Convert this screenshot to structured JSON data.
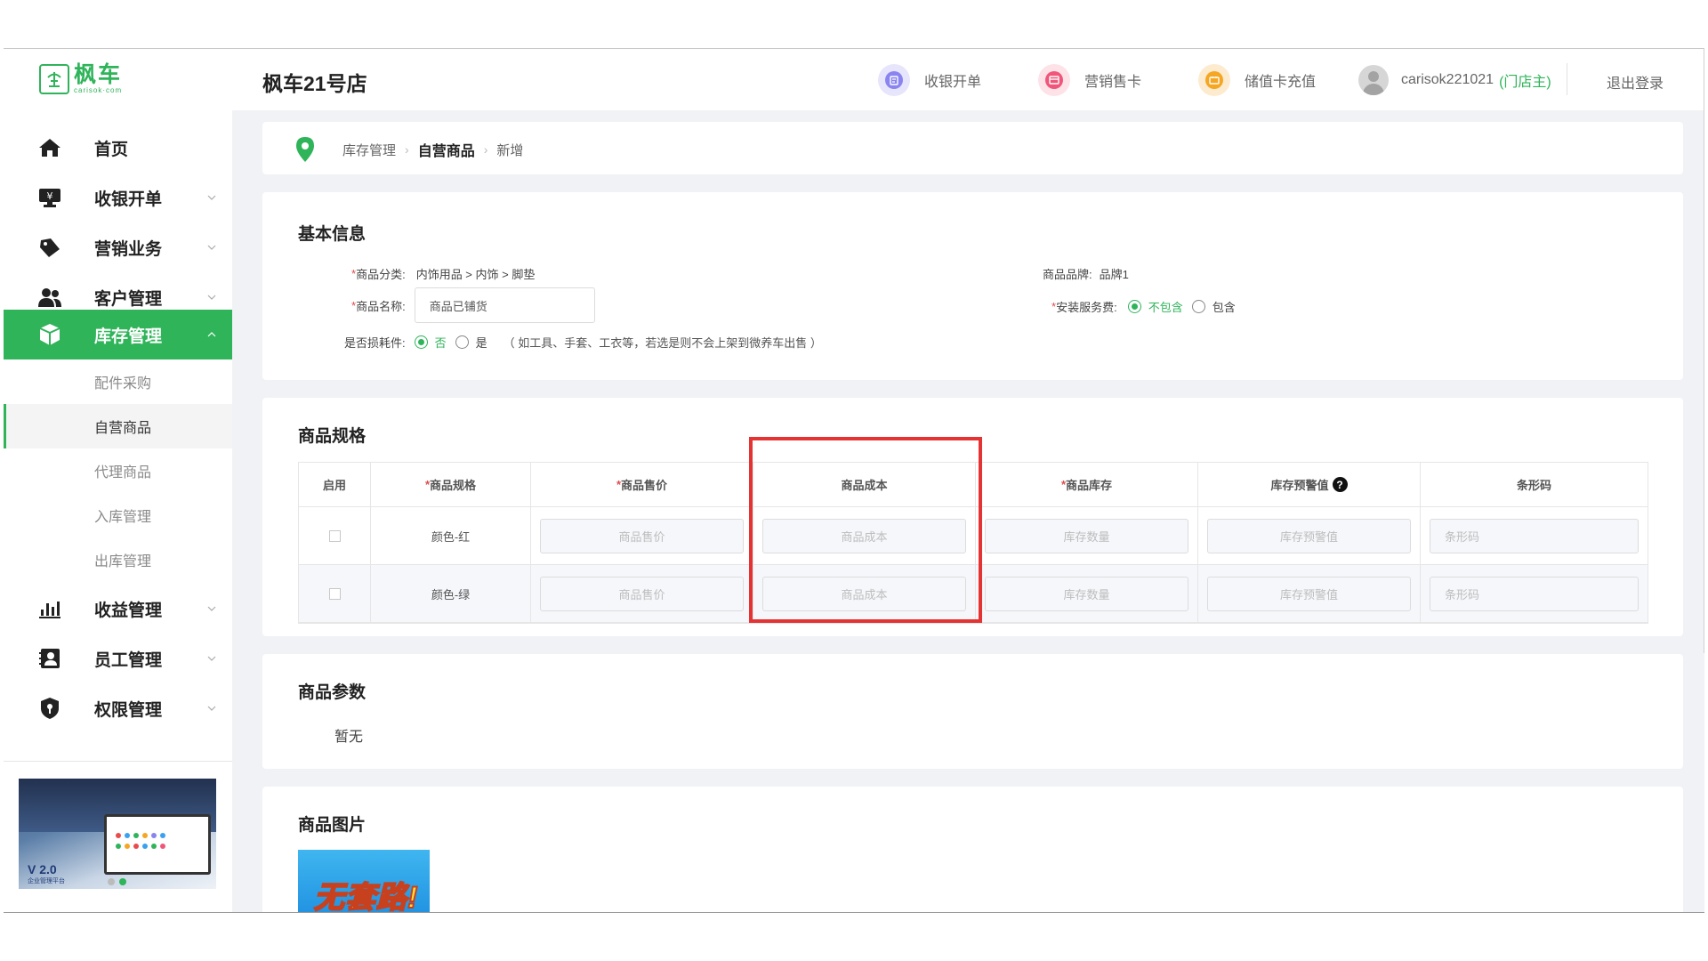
{
  "app": {
    "logo": {
      "cn": "枫车",
      "en": "carisok·com"
    },
    "shop_title": "枫车21号店",
    "brand_color": "#2fb45a"
  },
  "header": {
    "actions": [
      {
        "label": "收银开单",
        "icon": "cashier-order-icon",
        "color": "#8a84f0"
      },
      {
        "label": "营销售卡",
        "icon": "sell-card-icon",
        "color": "#f0567a"
      },
      {
        "label": "储值卡充值",
        "icon": "recharge-card-icon",
        "color": "#f5a623"
      }
    ],
    "user": {
      "name": "carisok221021",
      "role": "(门店主)"
    },
    "logout": "退出登录"
  },
  "sidebar": {
    "items": [
      {
        "label": "首页",
        "icon": "home-icon"
      },
      {
        "label": "收银开单",
        "icon": "cashier-icon"
      },
      {
        "label": "营销业务",
        "icon": "marketing-icon"
      },
      {
        "label": "客户管理",
        "icon": "customers-icon"
      },
      {
        "label": "库存管理",
        "icon": "inventory-box-icon",
        "active": true
      },
      {
        "label": "收益管理",
        "icon": "revenue-chart-icon"
      },
      {
        "label": "员工管理",
        "icon": "staff-icon"
      },
      {
        "label": "权限管理",
        "icon": "permission-shield-icon"
      }
    ],
    "sub_items": [
      {
        "label": "配件采购"
      },
      {
        "label": "自营商品",
        "active": true
      },
      {
        "label": "代理商品"
      },
      {
        "label": "入库管理"
      },
      {
        "label": "出库管理"
      }
    ],
    "promo": {
      "version": "V 2.0",
      "subtitle": "企业管理平台"
    }
  },
  "breadcrumb": [
    "库存管理",
    "自营商品",
    "新增"
  ],
  "basic_info": {
    "title": "基本信息",
    "category_label": "商品分类:",
    "category_value": "内饰用品 > 内饰 > 脚垫",
    "brand_label": "商品品牌:",
    "brand_value": "品牌1",
    "name_label": "商品名称:",
    "name_value": "商品已铺货",
    "install_label": "安装服务费:",
    "install_options": [
      "不包含",
      "包含"
    ],
    "install_selected": "不包含",
    "consumable_label": "是否损耗件:",
    "consumable_options": [
      "否",
      "是"
    ],
    "consumable_selected": "否",
    "consumable_hint": "（ 如工具、手套、工衣等，若选是则不会上架到微养车出售 ）"
  },
  "spec": {
    "title": "商品规格",
    "headers": [
      "启用",
      "商品规格",
      "商品售价",
      "商品成本",
      "商品库存",
      "库存预警值",
      "条形码"
    ],
    "rows": [
      {
        "spec": "颜色-红",
        "price": "商品售价",
        "cost": "商品成本",
        "stock": "库存数量",
        "warning": "库存预警值",
        "barcode": "条形码"
      },
      {
        "spec": "颜色-绿",
        "price": "商品售价",
        "cost": "商品成本",
        "stock": "库存数量",
        "warning": "库存预警值",
        "barcode": "条形码"
      }
    ],
    "help_glyph": "?"
  },
  "params": {
    "title": "商品参数",
    "empty": "暂无"
  },
  "images": {
    "title": "商品图片",
    "thumb_text": "无套路!"
  }
}
